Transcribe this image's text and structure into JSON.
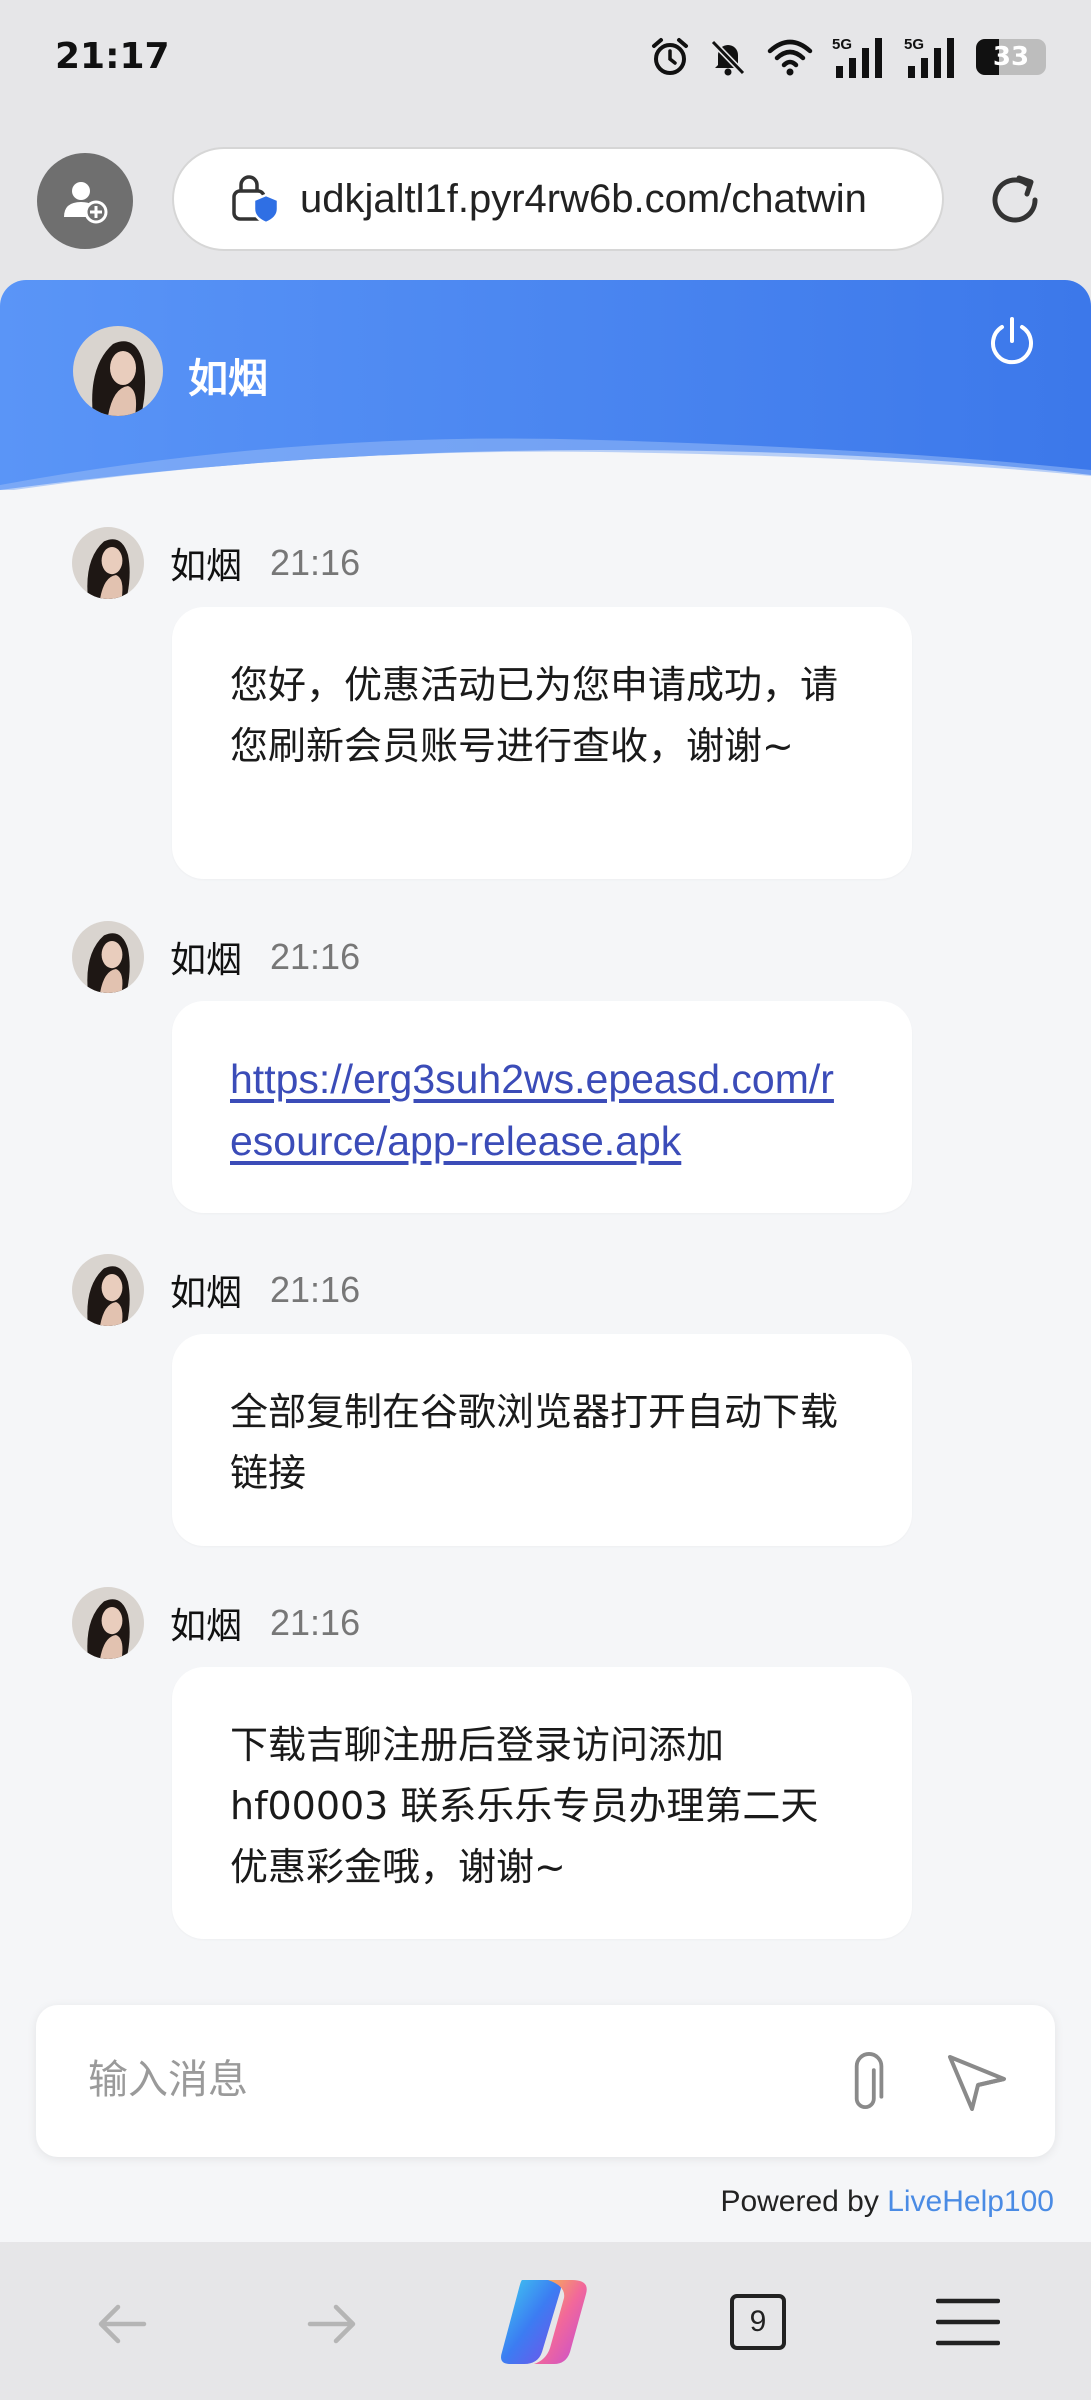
{
  "status_bar": {
    "time": "21:17",
    "battery": "33",
    "battery_level": 0.33,
    "icons": [
      "alarm-icon",
      "mute-bell-icon",
      "wifi-icon",
      "signal-5g-icon",
      "signal-5g-icon",
      "battery-icon"
    ],
    "network_labels": [
      "5G",
      "5G"
    ]
  },
  "browser": {
    "url": "udkjaltl1f.pyr4rw6b.com/chatwin",
    "icons": [
      "profile-add-icon",
      "secure-lock-icon",
      "reload-icon"
    ]
  },
  "chat": {
    "agent_name": "如烟",
    "header_color": "#4f8df5",
    "messages": [
      {
        "name": "如烟",
        "time": "21:16",
        "text": "您好，优惠活动已为您申请成功，请您刷新会员账号进行查收，谢谢~"
      },
      {
        "name": "如烟",
        "time": "21:16",
        "link": "https://erg3suh2ws.epeasd.com/resource/app-release.apk"
      },
      {
        "name": "如烟",
        "time": "21:16",
        "text": "全部复制在谷歌浏览器打开自动下载链接"
      },
      {
        "name": "如烟",
        "time": "21:16",
        "text": "下载吉聊注册后登录访问添加hf00003 联系乐乐专员办理第二天优惠彩金哦，谢谢~"
      }
    ],
    "input_placeholder": "输入消息",
    "powered_prefix": "Powered by ",
    "powered_brand": "LiveHelp100",
    "brand_color": "#4a8be4"
  },
  "bottom_nav": {
    "tab_count": "9",
    "icons": [
      "back-arrow-icon",
      "forward-arrow-icon",
      "copilot-icon",
      "tabs-icon",
      "menu-icon"
    ]
  }
}
